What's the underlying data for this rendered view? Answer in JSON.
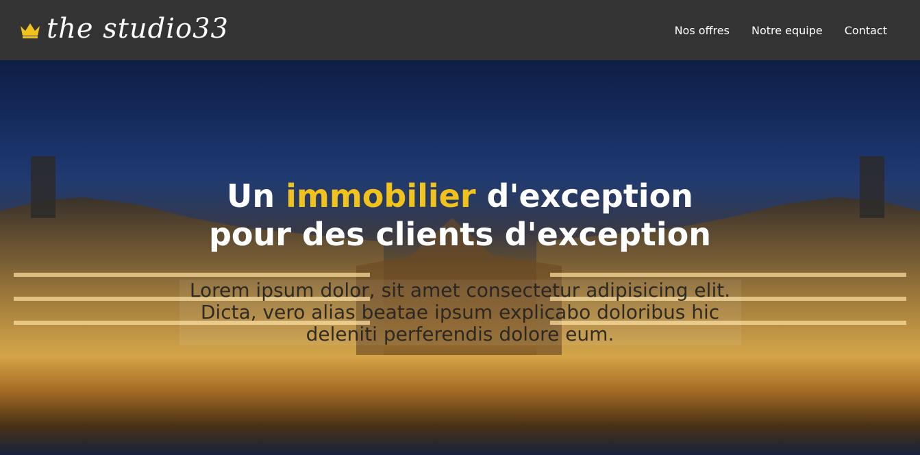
{
  "header": {
    "logo_text": "the studio33",
    "logo_icon": "crown-icon",
    "logo_icon_color": "#f2c21c",
    "background_color": "#333333",
    "nav": [
      {
        "label": "Nos offres"
      },
      {
        "label": "Notre equipe"
      },
      {
        "label": "Contact"
      }
    ]
  },
  "hero": {
    "title_part1": "Un ",
    "title_accent": "immobilier",
    "title_part2": " d'exception pour des clients d'exception",
    "accent_color": "#f2c21c",
    "subtitle": "Lorem ipsum dolor, sit amet consectetur adipisicing elit. Dicta, vero alias beatae ipsum explicabo doloribus hic deleniti perferendis dolore eum."
  }
}
